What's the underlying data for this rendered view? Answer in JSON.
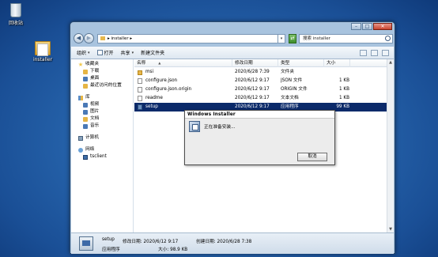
{
  "desktop": {
    "icons": [
      {
        "label": "回收站",
        "icon": "recycle-bin-icon"
      },
      {
        "label": "installer",
        "icon": "folder-icon"
      }
    ]
  },
  "explorer": {
    "window_buttons": {
      "minimize": "–",
      "maximize": "□",
      "close": "✕"
    },
    "address": {
      "prefix": "▸",
      "path": "installer",
      "arrow": "▸",
      "dropdown": "▾",
      "refresh": "⇄"
    },
    "search": {
      "placeholder": "搜索 installer"
    },
    "toolbar": {
      "organize": "组织",
      "open": "打开",
      "share": "共享",
      "new_folder": "新建文件夹",
      "chevron": "▾"
    },
    "nav": {
      "favorites": "收藏夹",
      "downloads": "下载",
      "desktop": "桌面",
      "recent": "最近访问的位置",
      "libraries": "库",
      "videos": "视频",
      "pictures": "图片",
      "documents": "文档",
      "music": "音乐",
      "computer": "计算机",
      "network": "网络",
      "tsclient": "tsclient"
    },
    "columns": {
      "name": "名称",
      "sort_arrow": "▲",
      "date": "修改日期",
      "type": "类型",
      "size": "大小"
    },
    "files": [
      {
        "name": "msi",
        "date": "2020/6/28 7:39",
        "type": "文件夹",
        "size": "",
        "icon": "folder-icon"
      },
      {
        "name": "configure.json",
        "date": "2020/6/12 9:17",
        "type": "JSON 文件",
        "size": "1 KB",
        "icon": "file-icon"
      },
      {
        "name": "configure.json.origin",
        "date": "2020/6/12 9:17",
        "type": "ORIGIN 文件",
        "size": "1 KB",
        "icon": "file-icon"
      },
      {
        "name": "readme",
        "date": "2020/6/12 9:17",
        "type": "文本文档",
        "size": "1 KB",
        "icon": "file-icon"
      },
      {
        "name": "setup",
        "date": "2020/6/12 9:17",
        "type": "应用程序",
        "size": "99 KB",
        "icon": "setup-icon"
      }
    ],
    "details": {
      "name": "setup",
      "type": "应用程序",
      "modified": "修改日期: 2020/6/12 9:17",
      "size": "大小: 98.9 KB",
      "created": "创建日期: 2020/6/28 7:38"
    }
  },
  "dialog": {
    "title": "Windows Installer",
    "message": "正在准备安装...",
    "cancel": "取消"
  }
}
